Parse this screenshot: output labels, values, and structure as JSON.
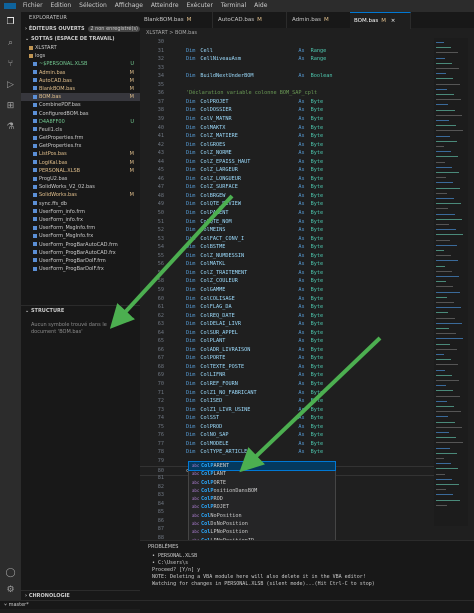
{
  "menu": [
    "Fichier",
    "Edition",
    "Sélection",
    "Affichage",
    "Atteindre",
    "Exécuter",
    "Terminal",
    "Aide"
  ],
  "sidebar": {
    "title": "EXPLORATEUR",
    "open_editors": "ÉDITEURS OUVERTS",
    "open_editors_badge": "2 non enregistré(s)",
    "workspace": "SOTTAS (ESPACE DE TRAVAIL)",
    "items": [
      {
        "label": "XLSTART",
        "state": "",
        "color": "norm"
      },
      {
        "label": "logs",
        "state": "",
        "color": "norm"
      },
      {
        "label": "~$PERSONAL.XLSB",
        "state": "U",
        "color": "unt"
      },
      {
        "label": "Admin.bas",
        "state": "M",
        "color": "mod"
      },
      {
        "label": "AutoCAD.bas",
        "state": "M",
        "color": "mod"
      },
      {
        "label": "BlankBOM.bas",
        "state": "M",
        "color": "mod"
      },
      {
        "label": "BOM.bas",
        "state": "M",
        "color": "mod"
      },
      {
        "label": "CombinePDF.bas",
        "state": "",
        "color": "norm"
      },
      {
        "label": "ConfiguredBOM.bas",
        "state": "",
        "color": "norm"
      },
      {
        "label": "D4A8FF00",
        "state": "U",
        "color": "unt"
      },
      {
        "label": "Feuil1.cls",
        "state": "",
        "color": "norm"
      },
      {
        "label": "GetProperties.frm",
        "state": "",
        "color": "norm"
      },
      {
        "label": "GetProperties.frx",
        "state": "",
        "color": "norm"
      },
      {
        "label": "ListPos.bas",
        "state": "M",
        "color": "mod"
      },
      {
        "label": "LogiKal.bas",
        "state": "M",
        "color": "mod"
      },
      {
        "label": "PERSONAL.XLSB",
        "state": "M",
        "color": "mod"
      },
      {
        "label": "ProgU2.bas",
        "state": "",
        "color": "norm"
      },
      {
        "label": "SolidWorks_V2_02.bas",
        "state": "",
        "color": "norm"
      },
      {
        "label": "SolidWorks.bas",
        "state": "M",
        "color": "mod"
      },
      {
        "label": "sync.ffs_db",
        "state": "",
        "color": "norm"
      },
      {
        "label": "UserForm_info.frm",
        "state": "",
        "color": "norm"
      },
      {
        "label": "UserForm_info.frx",
        "state": "",
        "color": "norm"
      },
      {
        "label": "UserForm_MsgInfo.frm",
        "state": "",
        "color": "norm"
      },
      {
        "label": "UserForm_MsgInfo.frx",
        "state": "",
        "color": "norm"
      },
      {
        "label": "UserForm_ProgBarAutoCAD.frm",
        "state": "",
        "color": "norm"
      },
      {
        "label": "UserForm_ProgBarAutoCAD.frx",
        "state": "",
        "color": "norm"
      },
      {
        "label": "UserForm_ProgBarDoIF.frm",
        "state": "",
        "color": "norm"
      },
      {
        "label": "UserForm_ProgBarDoIF.frx",
        "state": "",
        "color": "norm"
      }
    ],
    "structure_title": "STRUCTURE",
    "structure_empty": "Aucun symbole trouvé dans le document 'BOM.bas'",
    "timeline": "CHRONOLOGIE"
  },
  "tabs": [
    {
      "label": "BlankBOM.bas",
      "mark": "M"
    },
    {
      "label": "AutoCAD.bas",
      "mark": "M"
    },
    {
      "label": "Admin.bas",
      "mark": "M"
    },
    {
      "label": "BOM.bas",
      "mark": "M"
    }
  ],
  "breadcrumb": "XLSTART > BOM.bas",
  "code": [
    {
      "n": "30",
      "t": ""
    },
    {
      "n": "31",
      "kw": "Dim",
      "id": "Cell",
      "ty": "Range"
    },
    {
      "n": "32",
      "kw": "Dim",
      "id": "CellNiveauAsm",
      "ty": "Range"
    },
    {
      "n": "33",
      "t": ""
    },
    {
      "n": "34",
      "kw": "Dim",
      "id": "BuildNextUnderBOM",
      "ty": "Boolean"
    },
    {
      "n": "35",
      "t": ""
    },
    {
      "n": "36",
      "cm": "'Déclaration variable colonne BOM_SAP_cplt"
    },
    {
      "n": "37",
      "kw": "Dim",
      "id": "ColPROJET",
      "ty": "Byte"
    },
    {
      "n": "38",
      "kw": "Dim",
      "id": "ColDOSSIER",
      "ty": "Byte"
    },
    {
      "n": "39",
      "kw": "Dim",
      "id": "ColV_MATNR",
      "ty": "Byte"
    },
    {
      "n": "40",
      "kw": "Dim",
      "id": "ColMAKTX",
      "ty": "Byte"
    },
    {
      "n": "41",
      "kw": "Dim",
      "id": "ColZ_MATIERE",
      "ty": "Byte"
    },
    {
      "n": "42",
      "kw": "Dim",
      "id": "ColGROES",
      "ty": "Byte"
    },
    {
      "n": "43",
      "kw": "Dim",
      "id": "ColZ_NORME",
      "ty": "Byte"
    },
    {
      "n": "44",
      "kw": "Dim",
      "id": "ColZ_EPAISS_HAUT",
      "ty": "Byte"
    },
    {
      "n": "45",
      "kw": "Dim",
      "id": "ColZ_LARGEUR",
      "ty": "Byte"
    },
    {
      "n": "46",
      "kw": "Dim",
      "id": "ColZ_LONGUEUR",
      "ty": "Byte"
    },
    {
      "n": "47",
      "kw": "Dim",
      "id": "ColZ_SURFACE",
      "ty": "Byte"
    },
    {
      "n": "48",
      "kw": "Dim",
      "id": "ColBRGEW",
      "ty": "Byte"
    },
    {
      "n": "49",
      "kw": "Dim",
      "id": "ColQTE_REVIEW",
      "ty": "Byte"
    },
    {
      "n": "50",
      "kw": "Dim",
      "id": "ColPARENT",
      "ty": "Byte"
    },
    {
      "n": "51",
      "kw": "Dim",
      "id": "ColQTE_NOM",
      "ty": "Byte"
    },
    {
      "n": "52",
      "kw": "Dim",
      "id": "ColMEINS",
      "ty": "Byte"
    },
    {
      "n": "53",
      "kw": "Dim",
      "id": "ColFACT_CONV_I",
      "ty": "Byte"
    },
    {
      "n": "54",
      "kw": "Dim",
      "id": "ColBSTME",
      "ty": "Byte"
    },
    {
      "n": "55",
      "kw": "Dim",
      "id": "ColZ_NUMDESSIN",
      "ty": "Byte"
    },
    {
      "n": "56",
      "kw": "Dim",
      "id": "ColMATKL",
      "ty": "Byte"
    },
    {
      "n": "57",
      "kw": "Dim",
      "id": "ColZ_TRAITEMENT",
      "ty": "Byte"
    },
    {
      "n": "58",
      "kw": "Dim",
      "id": "ColZ_COULEUR",
      "ty": "Byte"
    },
    {
      "n": "59",
      "kw": "Dim",
      "id": "ColGAMME",
      "ty": "Byte"
    },
    {
      "n": "60",
      "kw": "Dim",
      "id": "ColCOLISAGE",
      "ty": "Byte"
    },
    {
      "n": "61",
      "kw": "Dim",
      "id": "ColFLAG_DA",
      "ty": "Byte"
    },
    {
      "n": "62",
      "kw": "Dim",
      "id": "ColREQ_DATE",
      "ty": "Byte"
    },
    {
      "n": "63",
      "kw": "Dim",
      "id": "ColDELAI_LIVR",
      "ty": "Byte"
    },
    {
      "n": "64",
      "kw": "Dim",
      "id": "ColSUR_APPEL",
      "ty": "Byte"
    },
    {
      "n": "65",
      "kw": "Dim",
      "id": "ColPLANT",
      "ty": "Byte"
    },
    {
      "n": "66",
      "kw": "Dim",
      "id": "ColADR_LIVRAISON",
      "ty": "Byte"
    },
    {
      "n": "67",
      "kw": "Dim",
      "id": "ColPORTE",
      "ty": "Byte"
    },
    {
      "n": "68",
      "kw": "Dim",
      "id": "ColTEXTE_POSTE",
      "ty": "Byte"
    },
    {
      "n": "69",
      "kw": "Dim",
      "id": "ColLIFNR",
      "ty": "Byte"
    },
    {
      "n": "70",
      "kw": "Dim",
      "id": "ColREF_FOURN",
      "ty": "Byte"
    },
    {
      "n": "71",
      "kw": "Dim",
      "id": "ColZ1_NO_FABRICANT",
      "ty": "Byte"
    },
    {
      "n": "72",
      "kw": "Dim",
      "id": "ColISED",
      "ty": "Byte"
    },
    {
      "n": "73",
      "kw": "Dim",
      "id": "ColZ1_LIVR_USINE",
      "ty": "Byte"
    },
    {
      "n": "74",
      "kw": "Dim",
      "id": "ColSST",
      "ty": "Byte"
    },
    {
      "n": "75",
      "kw": "Dim",
      "id": "ColPROD",
      "ty": "Byte"
    },
    {
      "n": "76",
      "kw": "Dim",
      "id": "ColNO_SAP",
      "ty": "Byte"
    },
    {
      "n": "77",
      "kw": "Dim",
      "id": "ColMODELE",
      "ty": "Byte"
    },
    {
      "n": "78",
      "kw": "Dim",
      "id": "ColTYPE_ARTICLE",
      "ty": "Byte"
    },
    {
      "n": "79",
      "t": ""
    },
    {
      "n": "80",
      "t": "colp"
    },
    {
      "n": "81",
      "t": ""
    },
    {
      "n": "82",
      "t": ""
    },
    {
      "n": "83",
      "t": ""
    },
    {
      "n": "84",
      "t": ""
    },
    {
      "n": "85",
      "t": ""
    },
    {
      "n": "86",
      "t": ""
    },
    {
      "n": "87",
      "t": ""
    },
    {
      "n": "88",
      "t": ""
    },
    {
      "n": "89",
      "t": ""
    }
  ],
  "as_keyword": "As",
  "suggestions": [
    {
      "pre": "Col",
      "hl": "P",
      "rest": "ARENT"
    },
    {
      "pre": "Col",
      "hl": "P",
      "rest": "LANT"
    },
    {
      "pre": "Col",
      "hl": "P",
      "rest": "ORTE"
    },
    {
      "pre": "Col",
      "hl": "P",
      "rest": "ositionDansBOM"
    },
    {
      "pre": "Col",
      "hl": "P",
      "rest": "ROD"
    },
    {
      "pre": "Col",
      "hl": "P",
      "rest": "ROJET"
    },
    {
      "pre": "Col",
      "hl": "",
      "rest": "NoPosition"
    },
    {
      "pre": "Col",
      "hl": "",
      "rest": "DsNoPosition"
    },
    {
      "pre": "Col",
      "hl": "",
      "rest": "LPNoPosition"
    },
    {
      "pre": "Col",
      "hl": "",
      "rest": "LPNoPositionID"
    },
    {
      "pre": "Col",
      "hl": "",
      "rest": "LPCouleur"
    },
    {
      "pre": "Col",
      "hl": "",
      "rest": "LPDescription"
    }
  ],
  "panel": {
    "tab": "PROBLÈMES",
    "lines": [
      "• PERSONAL.XLSB",
      "• C:\\Users\\s",
      "",
      "Proceed? [Y/n] y",
      "NOTE: Deleting a VBA module here will also delete it in the VBA editor!",
      "Watching for changes in PERSONAL.XLSB (silent mode)...(Hit Ctrl-C to stop)"
    ]
  },
  "status": "master*"
}
